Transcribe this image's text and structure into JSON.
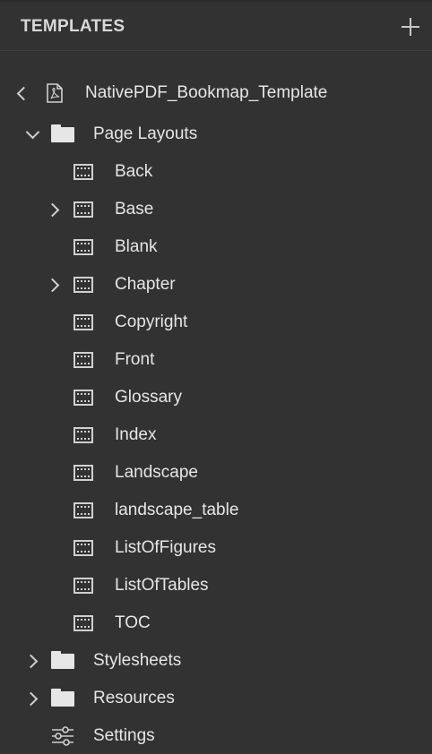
{
  "header": {
    "title": "TEMPLATES",
    "add_icon": "plus-icon"
  },
  "template": {
    "name": "NativePDF_Bookmap_Template",
    "icon": "pdf-file-icon"
  },
  "page_layouts": {
    "label": "Page Layouts",
    "expanded": true,
    "items": [
      {
        "label": "Back",
        "expandable": false
      },
      {
        "label": "Base",
        "expandable": true
      },
      {
        "label": "Blank",
        "expandable": false
      },
      {
        "label": "Chapter",
        "expandable": true
      },
      {
        "label": "Copyright",
        "expandable": false
      },
      {
        "label": "Front",
        "expandable": false
      },
      {
        "label": "Glossary",
        "expandable": false
      },
      {
        "label": "Index",
        "expandable": false
      },
      {
        "label": "Landscape",
        "expandable": false
      },
      {
        "label": "landscape_table",
        "expandable": false
      },
      {
        "label": "ListOfFigures",
        "expandable": false
      },
      {
        "label": "ListOfTables",
        "expandable": false
      },
      {
        "label": "TOC",
        "expandable": false
      }
    ]
  },
  "stylesheets": {
    "label": "Stylesheets",
    "expanded": false
  },
  "resources": {
    "label": "Resources",
    "expanded": false
  },
  "settings": {
    "label": "Settings",
    "icon": "sliders-icon"
  }
}
